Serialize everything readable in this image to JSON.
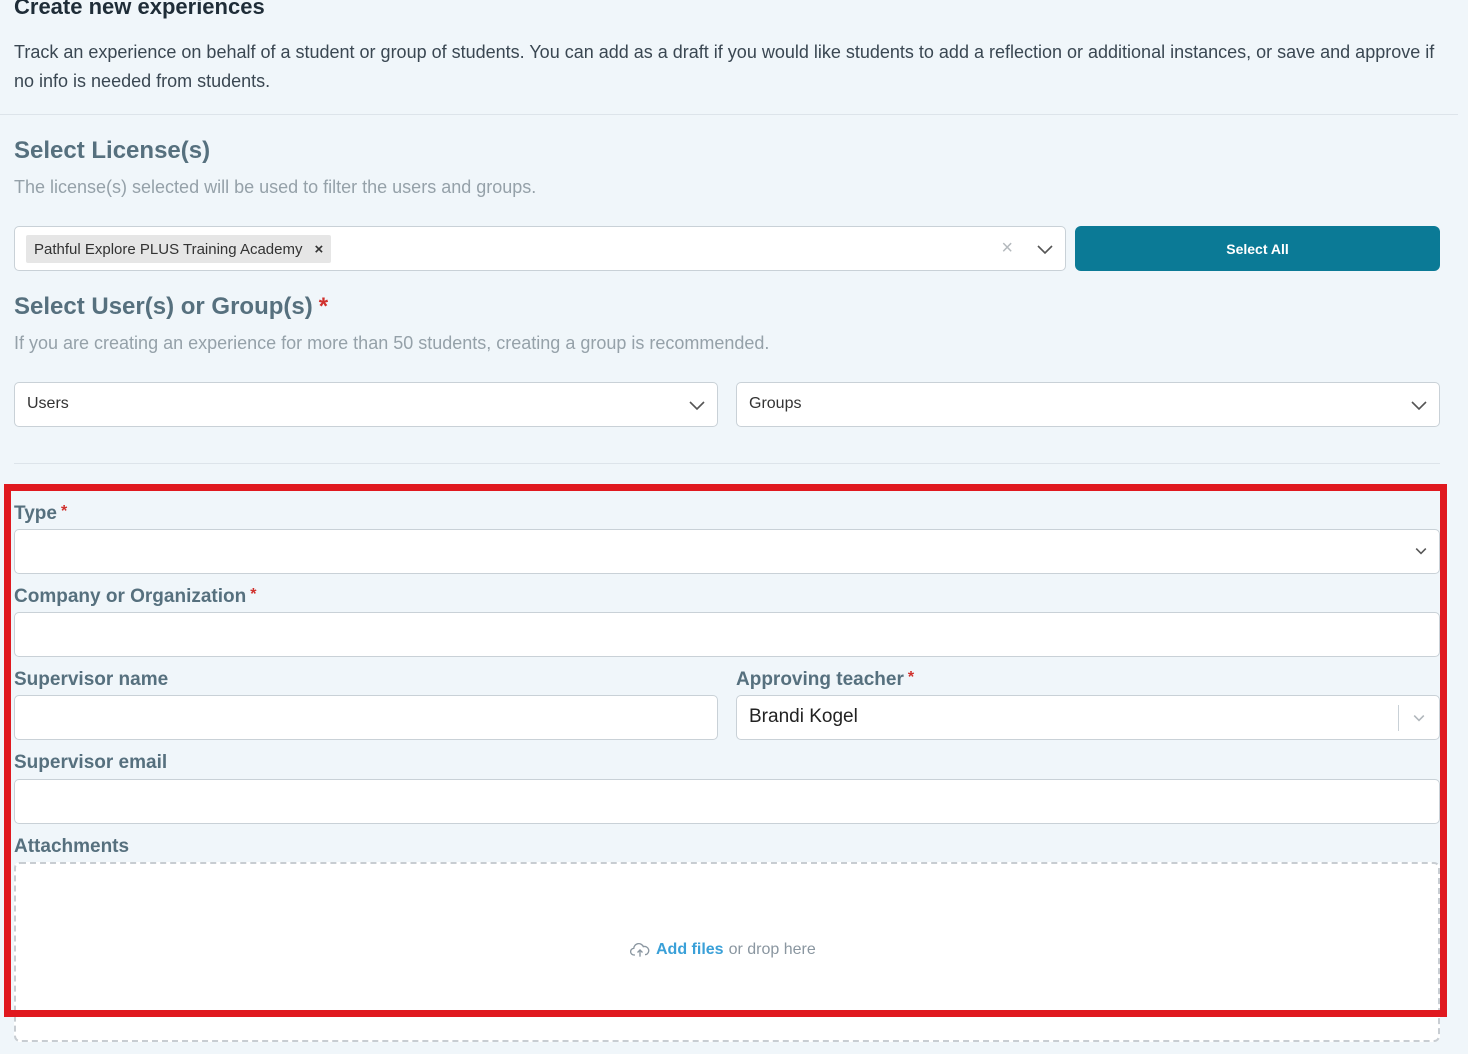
{
  "header": {
    "title": "Create new experiences",
    "intro": "Track an experience on behalf of a student or group of students. You can add as a draft if you would like students to add a reflection or additional instances, or save and approve if no info is needed from students."
  },
  "license_section": {
    "title": "Select License(s)",
    "description": "The license(s) selected will be used to filter the users and groups.",
    "selected_tag": "Pathful Explore PLUS Training Academy",
    "tag_remove": "×",
    "clear_icon": "×",
    "select_all_label": "Select All"
  },
  "users_section": {
    "title": "Select User(s) or Group(s)",
    "required_mark": "*",
    "description": "If you are creating an experience for more than 50 students, creating a group is recommended.",
    "users_placeholder": "Users",
    "groups_placeholder": "Groups"
  },
  "form": {
    "type_label": "Type",
    "company_label": "Company or Organization",
    "supervisor_name_label": "Supervisor name",
    "approving_teacher_label": "Approving teacher",
    "approving_teacher_value": "Brandi Kogel",
    "supervisor_email_label": "Supervisor email",
    "attachments_label": "Attachments",
    "add_files_label": "Add files",
    "drop_hint": "or drop here",
    "required_mark": "*"
  },
  "colors": {
    "accent": "#0b7a96",
    "required": "#d0312d",
    "highlight": "#e0191f",
    "link": "#3aa0d8"
  }
}
